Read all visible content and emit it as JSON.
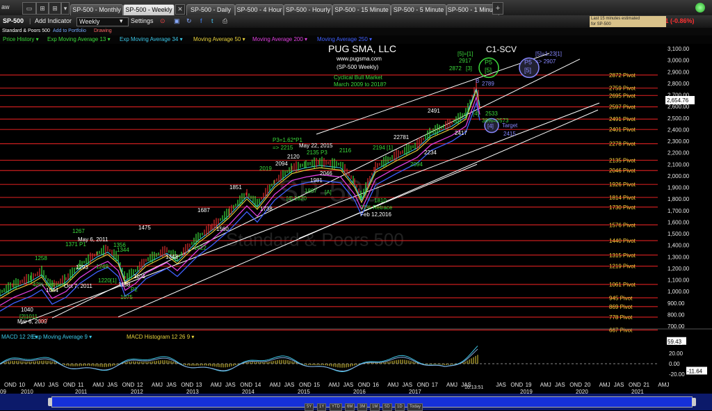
{
  "tabbar": {
    "left_label": "aw",
    "tabs": [
      {
        "label": "SP-500 - Monthly",
        "active": false
      },
      {
        "label": "SP-500 - Weekly",
        "active": true
      },
      {
        "label": "SP-500 - Daily",
        "active": false
      },
      {
        "label": "SP-500 - 4 Hour",
        "active": false
      },
      {
        "label": "SP-500 - Hourly",
        "active": false
      },
      {
        "label": "SP-500 - 15 Minute",
        "active": false
      },
      {
        "label": "SP-500 - 5 Minute",
        "active": false
      },
      {
        "label": "SP-500 - 1 Minute",
        "active": false
      }
    ],
    "close_glyph": "✕",
    "add_glyph": "+"
  },
  "toolbar": {
    "symbol": "SP-500",
    "add_indicator": "Add Indicator",
    "interval": "Weekly",
    "settings": "Settings",
    "change": "-22.91 (-0.86%)",
    "quote_note_line1": "Last 15 minutes estimated",
    "quote_note_line2": "for SP-500"
  },
  "infobar": {
    "name": "Standard & Poors 500",
    "add_portfolio": "Add to Portfolio",
    "drawing": "Drawing"
  },
  "indicators": [
    {
      "label": "Price History ▾",
      "color": "#3cdc3c"
    },
    {
      "label": "Exp Moving Average 13 ▾",
      "color": "#3cdc3c"
    },
    {
      "label": "Exp Moving Average 34 ▾",
      "color": "#3cc8e8"
    },
    {
      "label": "Moving Average 50 ▾",
      "color": "#e8d23c"
    },
    {
      "label": "Moving Average 200 ▾",
      "color": "#e040e0"
    },
    {
      "label": "Moving Average 250 ▾",
      "color": "#4060ff"
    }
  ],
  "chart": {
    "title": "PUG SMA, LLC",
    "site": "www.pugsma.com",
    "subtitle": "(SP-500 Weekly)",
    "note1": "Cyclical Bull Market",
    "note2": "March 2009 to 2018?",
    "watermark1": "SP-500",
    "watermark2": "Standard & Poors 500",
    "current_price": "2,654.76",
    "price_axis": [
      "3,100.00",
      "3,000.00",
      "2,900.00",
      "2,800.00",
      "2,700.00",
      "2,600.00",
      "2,500.00",
      "2,400.00",
      "2,300.00",
      "2,200.00",
      "2,100.00",
      "2,000.00",
      "1,900.00",
      "1,800.00",
      "1,700.00",
      "1,600.00",
      "1,500.00",
      "1,400.00",
      "1,300.00",
      "1,200.00",
      "1,100.00",
      "1,000.00",
      "900.00",
      "800.00",
      "700.00"
    ],
    "pivots": [
      {
        "label": "2872 Pivot",
        "value": 2872
      },
      {
        "label": "2759 Pivot",
        "value": 2759
      },
      {
        "label": "2695 Pivot",
        "value": 2695
      },
      {
        "label": "2597 Pivot",
        "value": 2597
      },
      {
        "label": "2491 Pivot",
        "value": 2491
      },
      {
        "label": "2401 Pivot",
        "value": 2401
      },
      {
        "label": "2278 Pivot",
        "value": 2278
      },
      {
        "label": "2135 Pivot",
        "value": 2135
      },
      {
        "label": "2046 Pivot",
        "value": 2046
      },
      {
        "label": "1926 Pivot",
        "value": 1926
      },
      {
        "label": "1814 Pivot",
        "value": 1814
      },
      {
        "label": "1730 Pivot",
        "value": 1730
      },
      {
        "label": "1576 Pivot",
        "value": 1576
      },
      {
        "label": "1440 Pivot",
        "value": 1440
      },
      {
        "label": "1315 Pivot",
        "value": 1315
      },
      {
        "label": "1219 Pivot",
        "value": 1219
      },
      {
        "label": "1061 Pivot",
        "value": 1061
      },
      {
        "label": "945 Pivot",
        "value": 945
      },
      {
        "label": "869 Pivot",
        "value": 869
      },
      {
        "label": "778 Pivot",
        "value": 778
      },
      {
        "label": "667 Pivot",
        "value": 667
      }
    ],
    "annotations": [
      {
        "t": "[5]=[1]",
        "c": "#3cdc3c"
      },
      {
        "t": "2917",
        "c": "#3cdc3c"
      },
      {
        "t": "2872",
        "c": "#3cdc3c"
      },
      {
        "t": "[3]",
        "c": "#3cdc3c"
      },
      {
        "t": "C1-SCV",
        "c": "#ffffff"
      },
      {
        "t": "[5]=1.23[1]",
        "c": "#8888ff"
      },
      {
        "t": "=> 2907",
        "c": "#8888ff"
      },
      {
        "t": "B",
        "c": "#8888ff"
      },
      {
        "t": "2789",
        "c": "#8888ff"
      },
      {
        "t": "[4]",
        "c": "#3cdc3c"
      },
      {
        "t": "2533",
        "c": "#3cdc3c"
      },
      {
        "t": "38%=2573",
        "c": "#3cdc3c"
      },
      {
        "t": "Target",
        "c": "#8888ff"
      },
      {
        "t": "2415",
        "c": "#8888ff"
      },
      {
        "t": "2491",
        "c": "#ffffff"
      },
      {
        "t": "2417",
        "c": "#ffffff"
      },
      {
        "t": "22781",
        "c": "#ffffff"
      },
      {
        "t": "2234",
        "c": "#ffffff"
      },
      {
        "t": "2094",
        "c": "#3cdc3c"
      },
      {
        "t": "2194 [1]",
        "c": "#3cdc3c"
      },
      {
        "t": "P3=1.62*P1",
        "c": "#3cdc3c"
      },
      {
        "t": "=> 2215",
        "c": "#3cdc3c"
      },
      {
        "t": "May 22, 2015",
        "c": "#ffffff"
      },
      {
        "t": "2135 P3",
        "c": "#3cdc3c"
      },
      {
        "t": "2116",
        "c": "#3cdc3c"
      },
      {
        "t": "2120",
        "c": "#ffffff"
      },
      {
        "t": "2094",
        "c": "#ffffff"
      },
      {
        "t": "2046",
        "c": "#ffffff"
      },
      {
        "t": "1981",
        "c": "#ffffff"
      },
      {
        "t": "1867",
        "c": "#3cdc3c"
      },
      {
        "t": "[A]",
        "c": "#3cdc3c"
      },
      {
        "t": "1810",
        "c": "#3cdc3c"
      },
      {
        "t": "31% Retrace",
        "c": "#3cdc3c"
      },
      {
        "t": "Feb 12,2016",
        "c": "#ffffff"
      },
      {
        "t": "2019",
        "c": "#3cdc3c"
      },
      {
        "t": "1851",
        "c": "#ffffff"
      },
      {
        "t": "1738",
        "c": "#ffffff"
      },
      {
        "t": "[4] 1820",
        "c": "#3cdc3c"
      },
      {
        "t": "1687",
        "c": "#ffffff"
      },
      {
        "t": "1560",
        "c": "#ffffff"
      },
      {
        "t": "1475",
        "c": "#ffffff"
      },
      {
        "t": "1422",
        "c": "#3cdc3c"
      },
      {
        "t": "1343",
        "c": "#ffffff"
      },
      {
        "t": "1267",
        "c": "#3cdc3c"
      },
      {
        "t": "May 6, 2011",
        "c": "#ffffff"
      },
      {
        "t": "1371 P1",
        "c": "#3cdc3c"
      },
      {
        "t": "1344",
        "c": "#3cdc3c"
      },
      {
        "t": "1356",
        "c": "#3cdc3c"
      },
      {
        "t": "1293",
        "c": "#ffffff"
      },
      {
        "t": "1249",
        "c": "#3cdc3c"
      },
      {
        "t": "1258",
        "c": "#3cdc3c"
      },
      {
        "t": "1220[1]",
        "c": "#3cdc3c"
      },
      {
        "t": "1101",
        "c": "#ffffff"
      },
      {
        "t": "1158",
        "c": "#ffffff"
      },
      {
        "t": "P2",
        "c": "#3cdc3c"
      },
      {
        "t": "1075",
        "c": "#3cdc3c"
      },
      {
        "t": "42% Retrace",
        "c": "#3cdc3c"
      },
      {
        "t": "Oct 7, 2011",
        "c": "#ffffff"
      },
      {
        "t": "1044",
        "c": "#ffffff"
      },
      {
        "t": "1040",
        "c": "#ffffff"
      },
      {
        "t": "[2]1011",
        "c": "#3cdc3c"
      },
      {
        "t": "Mar 6, 2009",
        "c": "#ffffff"
      },
      {
        "t": "667",
        "c": "#ff3030"
      },
      {
        "t": "C-C",
        "c": "#ff3030"
      },
      {
        "t": "SC-IV",
        "c": "#ffffff"
      }
    ]
  },
  "macd": {
    "labels": [
      {
        "t": "MACD 12 26 ▾",
        "c": "#3cc8e8"
      },
      {
        "t": "Exp Moving Average 9 ▾",
        "c": "#3cc8e8"
      },
      {
        "t": "MACD Histogram 12 26 9 ▾",
        "c": "#e8d23c"
      }
    ],
    "axis": [
      "40.00",
      "20.00",
      "0.00",
      "-20.00"
    ],
    "value_top": "59.43",
    "value_bottom": "-11.64"
  },
  "time_axis": {
    "labels": [
      "OND",
      "10",
      "AMJ",
      "JAS",
      "OND",
      "11",
      "AMJ",
      "JAS",
      "OND",
      "12",
      "AMJ",
      "JAS",
      "OND",
      "13",
      "AMJ",
      "JAS",
      "OND",
      "14",
      "AMJ",
      "JAS",
      "OND",
      "15",
      "AMJ",
      "JAS",
      "OND",
      "16",
      "AMJ",
      "JAS",
      "OND",
      "17",
      "AMJ",
      "JAS",
      "JAS",
      "OND",
      "19",
      "AMJ",
      "JAS",
      "OND",
      "20",
      "AMJ",
      "JAS",
      "OND",
      "21",
      "AMJ"
    ],
    "years": [
      "09",
      "2010",
      "2011",
      "2012",
      "2013",
      "2014",
      "2015",
      "2016",
      "2017",
      "2019",
      "2020",
      "2021"
    ],
    "time": "10:13:51"
  },
  "bottom": {
    "buttons": [
      "5Y",
      "1Y",
      "YTD",
      "6M",
      "3M",
      "1M",
      "5D",
      "1D",
      "Today"
    ]
  },
  "colors": {
    "pivot_line": "#c81e1e",
    "channel": "#ffffff",
    "price_up": "#3cdc3c",
    "ema34": "#3cc8e8",
    "ma50": "#e8d23c",
    "ma200": "#e040e0",
    "ma250": "#4060ff",
    "change_down": "#ff3030"
  }
}
